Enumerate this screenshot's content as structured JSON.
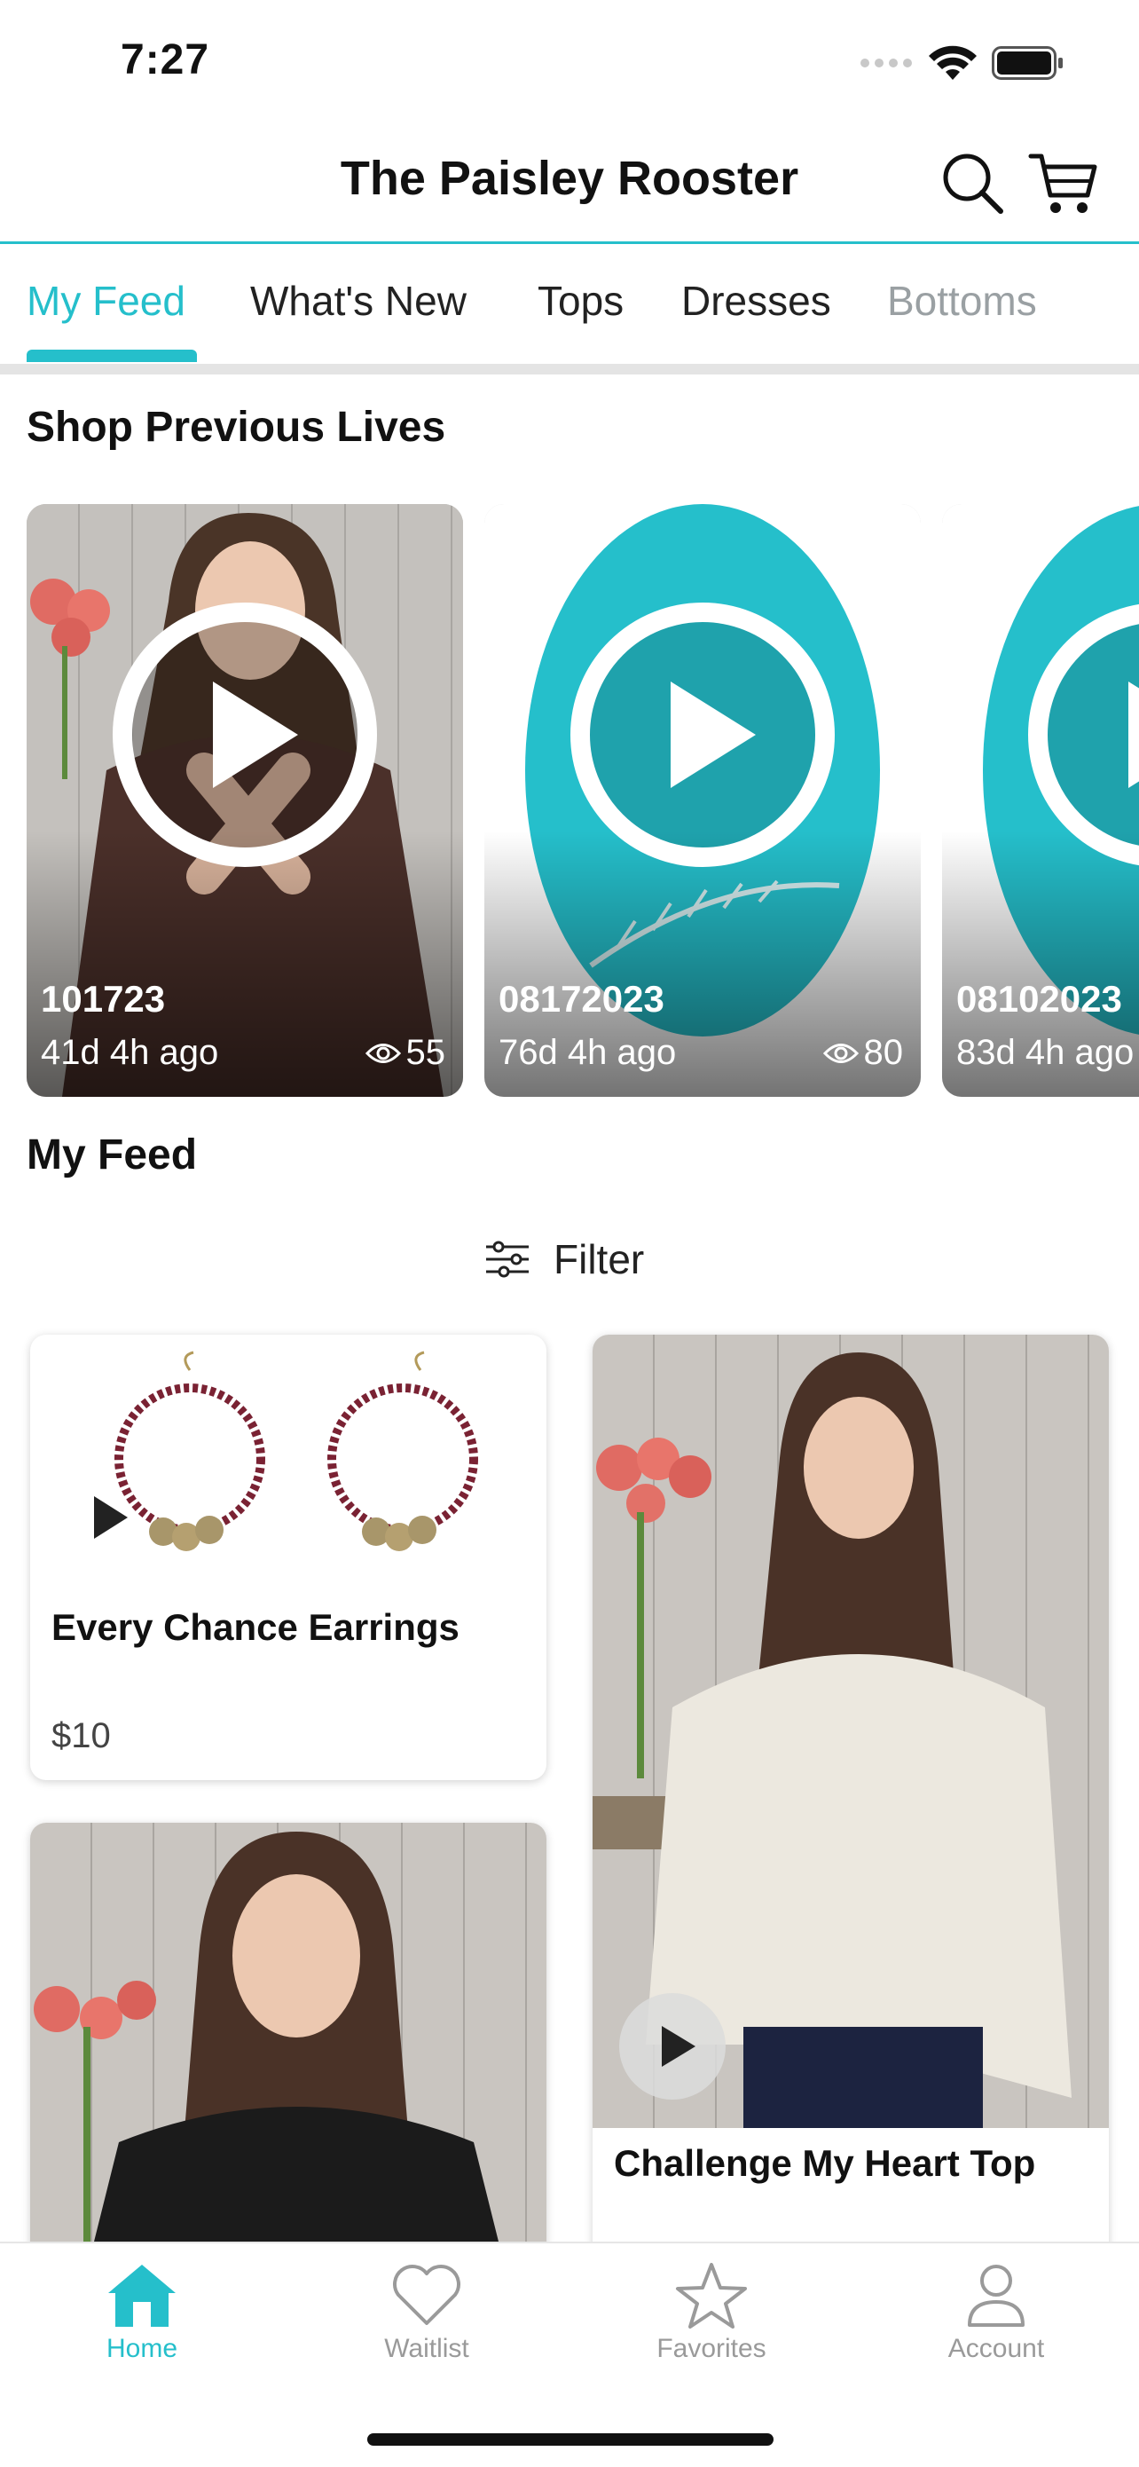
{
  "status_bar": {
    "time": "7:27"
  },
  "header": {
    "title": "The Paisley Rooster"
  },
  "tabs": [
    {
      "label": "My Feed"
    },
    {
      "label": "What's New"
    },
    {
      "label": "Tops"
    },
    {
      "label": "Dresses"
    },
    {
      "label": "Bottoms"
    }
  ],
  "sections": {
    "lives_title": "Shop Previous Lives",
    "feed_title": "My Feed"
  },
  "lives": [
    {
      "name": "101723",
      "ago": "41d 4h ago",
      "views": "55"
    },
    {
      "name": "08172023",
      "ago": "76d 4h ago",
      "views": "80"
    },
    {
      "name": "08102023",
      "ago": "83d 4h ago",
      "views": ""
    }
  ],
  "filter": {
    "label": "Filter"
  },
  "products": [
    {
      "name": "Every Chance Earrings",
      "price": "$10"
    },
    {
      "name": "Challenge My Heart Top",
      "price": ""
    }
  ],
  "bottom_nav": [
    {
      "label": "Home"
    },
    {
      "label": "Waitlist"
    },
    {
      "label": "Favorites"
    },
    {
      "label": "Account"
    }
  ],
  "colors": {
    "accent": "#25bfcb",
    "inactive": "#9a9a9a"
  }
}
